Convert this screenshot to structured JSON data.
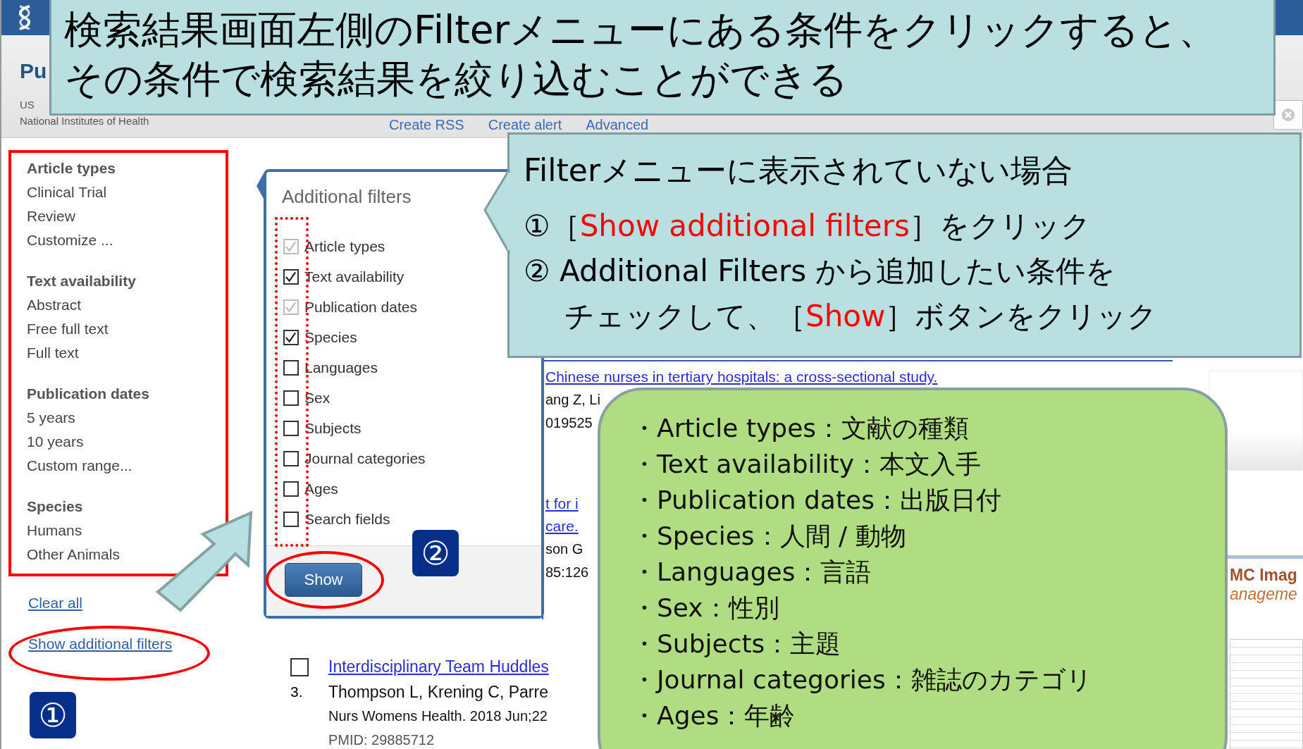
{
  "page_header": {
    "logo_text": "Pu",
    "org_lines": [
      "US",
      "National Institutes of Health"
    ],
    "links": [
      "Create RSS",
      "Create alert",
      "Advanced"
    ]
  },
  "sidebar": {
    "groups": [
      {
        "title": "Article types",
        "items": [
          "Clinical Trial",
          "Review",
          "Customize ..."
        ]
      },
      {
        "title": "Text availability",
        "items": [
          "Abstract",
          "Free full text",
          "Full text"
        ]
      },
      {
        "title": "Publication dates",
        "items": [
          "5 years",
          "10 years",
          "Custom range..."
        ]
      },
      {
        "title": "Species",
        "items": [
          "Humans",
          "Other Animals"
        ]
      }
    ],
    "links": [
      "Clear all",
      "Show additional filters"
    ]
  },
  "filter_popup": {
    "title": "Additional filters",
    "options": [
      {
        "label": "Article types",
        "checked": true,
        "disabled": true
      },
      {
        "label": "Text availability",
        "checked": true,
        "disabled": false
      },
      {
        "label": "Publication dates",
        "checked": true,
        "disabled": true
      },
      {
        "label": "Species",
        "checked": true,
        "disabled": false
      },
      {
        "label": "Languages",
        "checked": false,
        "disabled": false
      },
      {
        "label": "Sex",
        "checked": false,
        "disabled": false
      },
      {
        "label": "Subjects",
        "checked": false,
        "disabled": false
      },
      {
        "label": "Journal categories",
        "checked": false,
        "disabled": false
      },
      {
        "label": "Ages",
        "checked": false,
        "disabled": false
      },
      {
        "label": "Search fields",
        "checked": false,
        "disabled": false
      }
    ],
    "button": "Show"
  },
  "results": [
    {
      "kind": "partial",
      "title_lines": [
        "Chinese nurses in tertiary hospitals: a cross-sectional study."
      ],
      "lines": [
        "ang Z, Li",
        "019525"
      ]
    },
    {
      "kind": "partial",
      "title_lines": [
        "t for i",
        "care."
      ],
      "lines": [
        "son G",
        "85:126"
      ]
    },
    {
      "kind": "full",
      "number": "3.",
      "checked": false,
      "title_lines": [
        "Interdisciplinary Team Huddles"
      ],
      "lines": [
        "Thompson L, Krening C, Parre",
        "Nurs Womens Health. 2018 Jun;22",
        "PMID: 29885712"
      ]
    }
  ],
  "side_panel": {
    "heading": "MC Imag",
    "subtitle": "anageme"
  },
  "callout_top": {
    "lines": [
      "検索結果画面左側のFilterメニューにある条件をクリックすると、",
      "その条件で検索結果を絞り込むことができる"
    ]
  },
  "callout_steps": {
    "heading": "Filterメニューに表示されていない場合",
    "lines": [
      [
        {
          "text": "①［",
          "highlight": false
        },
        {
          "text": "Show additional filters",
          "highlight": true
        },
        {
          "text": "］をクリック",
          "highlight": false
        }
      ],
      [
        {
          "text": "② Additional Filters から追加したい条件を",
          "highlight": false
        }
      ],
      [
        {
          "text": "チェックして、［",
          "highlight": false
        },
        {
          "text": "Show",
          "highlight": true
        },
        {
          "text": "］ボタンをクリック",
          "highlight": false
        }
      ]
    ]
  },
  "glossary": {
    "items": [
      "・Article types：文献の種類",
      "・Text availability：本文入手",
      "・Publication dates：出版日付",
      "・Species：人間 / 動物",
      "・Languages：言語",
      "・Sex：性別",
      "・Subjects：主題",
      "・Journal categories：雑誌のカテゴリ",
      "・Ages：年齢"
    ]
  },
  "step_badges": [
    "①",
    "②"
  ]
}
